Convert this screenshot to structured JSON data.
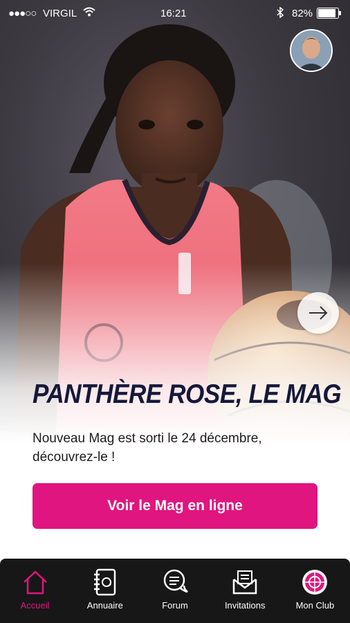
{
  "status_bar": {
    "signal": "●●●○○",
    "carrier": "VIRGIL",
    "time": "16:21",
    "battery": "82%"
  },
  "hero": {
    "title": "PANTHÈRE ROSE, LE MAG",
    "description": "Nouveau Mag est sorti le 24 décembre, découvrez-le !",
    "cta_label": "Voir le Mag en ligne"
  },
  "tabbar": {
    "items": [
      {
        "label": "Accueil",
        "icon": "home-icon",
        "active": true
      },
      {
        "label": "Annuaire",
        "icon": "address-book-icon",
        "active": false
      },
      {
        "label": "Forum",
        "icon": "chat-bubbles-icon",
        "active": false
      },
      {
        "label": "Invitations",
        "icon": "envelope-icon",
        "active": false
      },
      {
        "label": "Mon Club",
        "icon": "club-logo-icon",
        "active": false
      }
    ]
  },
  "colors": {
    "accent": "#e0157f",
    "title": "#15183a",
    "tabbar_bg": "#171717"
  }
}
